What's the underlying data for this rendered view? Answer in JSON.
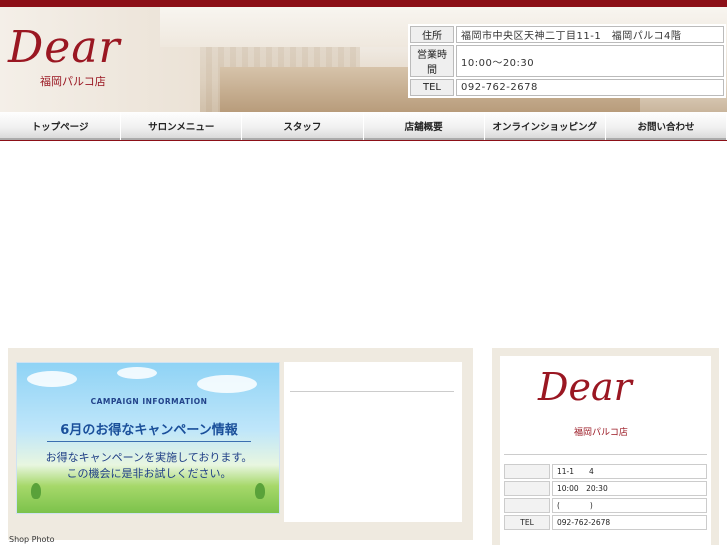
{
  "header": {
    "logo": "Dear",
    "store_name": "福岡パルコ店",
    "info": [
      {
        "label": "住所",
        "value": "福岡市中央区天神二丁目11-1　福岡パルコ4階"
      },
      {
        "label": "営業時間",
        "value": "10:00〜20:30"
      },
      {
        "label": "TEL",
        "value": "092-762-2678"
      }
    ]
  },
  "nav": [
    "トップページ",
    "サロンメニュー",
    "スタッフ",
    "店舗概要",
    "オンラインショッピング",
    "お問い合わせ"
  ],
  "banner": {
    "campaign": "CAMPAIGN INFORMATION",
    "title": "6月のお得なキャンペーン情報",
    "line1": "お得なキャンペーンを実施しております。",
    "line2": "この機会に是非お試しください。"
  },
  "shop_photo_label": "Shop Photo",
  "sidebar": {
    "logo": "Dear",
    "store_name": "福岡パルコ店",
    "rows": [
      {
        "label": "",
        "value": "11-1　　4"
      },
      {
        "label": "",
        "value": "10:00　20:30"
      },
      {
        "label": "",
        "value": "(　　　　)"
      },
      {
        "label": "TEL",
        "value": "092-762-2678"
      }
    ]
  },
  "colors": {
    "brand": "#9a1722",
    "accent_bar": "#8c0f17"
  }
}
